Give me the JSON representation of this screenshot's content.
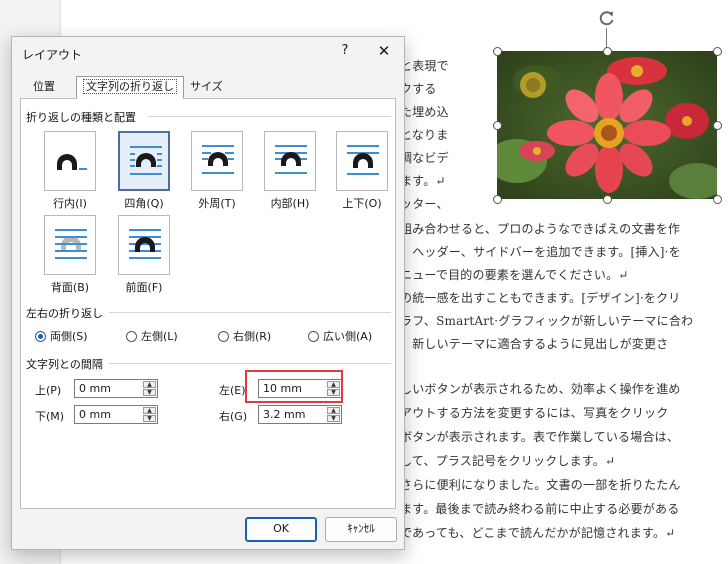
{
  "document": {
    "lines": [
      "と表現で",
      "クする",
      "た埋め込",
      "となりま",
      "調なビデ",
      "ます。↵",
      "ッター、",
      "組み合わせると、プロのようなできばえの文書を作",
      "、ヘッダー、サイドバーを追加できます。[挿入]·を",
      "ニューで目的の要素を選んでください。↵",
      "の統一感を出すこともできます。[デザイン]·をクリ",
      "ラフ、SmartArt·グラフィックが新しいテーマに合わ",
      "、新しいテーマに適合するように見出しが変更さ",
      "しいボタンが表示されるため、効率よく操作を進め",
      "アウトする方法を変更するには、写真をクリック",
      "ボタンが表示されます。表で作業している場合は、",
      "して、プラス記号をクリックします。↵",
      "さらに便利になりました。文書の一部を折りたたん",
      "ます。最後まで読み終わる前に中止する必要がある",
      "であっても、どこまで読んだかが記憶されます。↵"
    ],
    "anchor_mark": "↵"
  },
  "dialog": {
    "title": "レイアウト",
    "help": "?",
    "close": "✕",
    "tabs": [
      "位置",
      "文字列の折り返し",
      "サイズ"
    ],
    "wrap_section": "折り返しの種類と配置",
    "wrap_options": [
      "行内(I)",
      "四角(Q)",
      "外周(T)",
      "内部(H)",
      "上下(O)",
      "背面(B)",
      "前面(F)"
    ],
    "side_section": "左右の折り返し",
    "side_options": [
      "両側(S)",
      "左側(L)",
      "右側(R)",
      "広い側(A)"
    ],
    "selected_side": "両側(S)",
    "distance_section": "文字列との間隔",
    "distances": {
      "top_label": "上(P)",
      "top_value": "0 mm",
      "bottom_label": "下(M)",
      "bottom_value": "0 mm",
      "left_label": "左(E)",
      "left_value": "10 mm",
      "right_label": "右(G)",
      "right_value": "3.2 mm"
    },
    "ok": "OK",
    "cancel": "ｷｬﾝｾﾙ"
  },
  "colors": {
    "accent": "#1b5fb4",
    "highlight": "#e33b3b",
    "icon_blue": "#3d8fd1"
  }
}
